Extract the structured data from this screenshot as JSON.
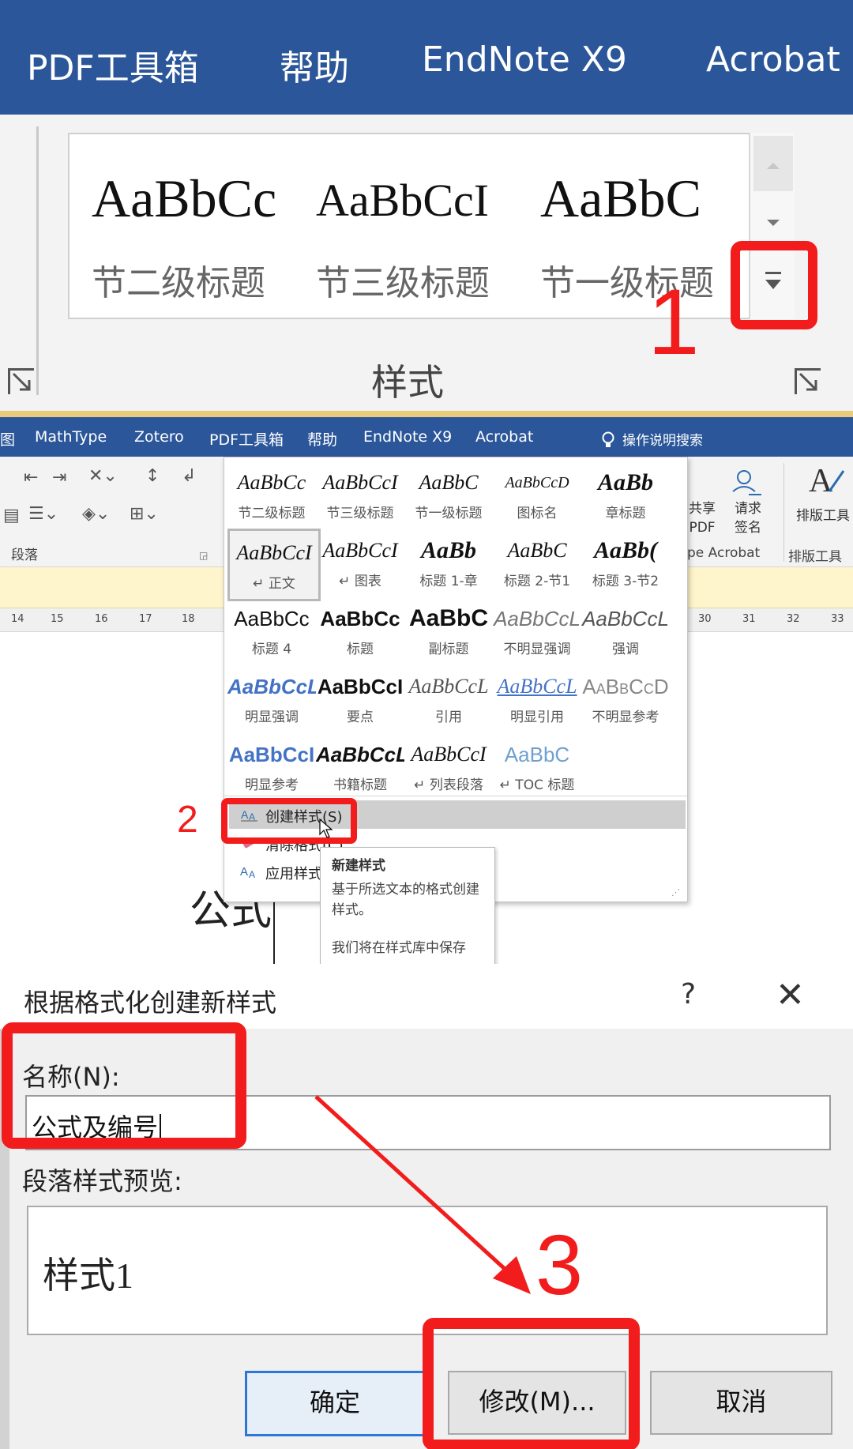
{
  "panel1": {
    "tabs": [
      "PDF工具箱",
      "帮助",
      "EndNote X9",
      "Acrobat"
    ],
    "gallery": [
      {
        "preview": "AaBbCc",
        "name": "节二级标题"
      },
      {
        "preview": "AaBbCcI",
        "name": "节三级标题"
      },
      {
        "preview": "AaBbC",
        "name": "节一级标题"
      }
    ],
    "group_label": "样式",
    "step_number": "1"
  },
  "panel2": {
    "tabs": [
      "图",
      "MathType",
      "Zotero",
      "PDF工具箱",
      "帮助",
      "EndNote X9",
      "Acrobat",
      "操作说明搜索"
    ],
    "ribbon": {
      "paragraph_group": "段落",
      "share_pdf": [
        "共享",
        "PDF"
      ],
      "request_sign": [
        "请求",
        "签名"
      ],
      "typeset_tool": "排版工具",
      "typeset_group": "排版工具箱",
      "acrobat_group": "pe Acrobat"
    },
    "ruler_numbers": [
      "14",
      "15",
      "16",
      "17",
      "18",
      "30",
      "31",
      "32",
      "33"
    ],
    "styles": [
      {
        "preview": "AaBbCc",
        "name": "节二级标题"
      },
      {
        "preview": "AaBbCcI",
        "name": "节三级标题"
      },
      {
        "preview": "AaBbC",
        "name": "节一级标题"
      },
      {
        "preview": "AaBbCcD",
        "name": "图标名"
      },
      {
        "preview": "AaBb",
        "name": "章标题"
      },
      {
        "preview": "AaBbCcI",
        "name": "↵ 正文"
      },
      {
        "preview": "AaBbCcI",
        "name": "↵ 图表"
      },
      {
        "preview": "AaBb",
        "name": "标题 1-章"
      },
      {
        "preview": "AaBbC",
        "name": "标题 2-节1"
      },
      {
        "preview": "AaBb(",
        "name": "标题 3-节2"
      },
      {
        "preview": "AaBbCc",
        "name": "标题 4"
      },
      {
        "preview": "AaBbCc",
        "name": "标题"
      },
      {
        "preview": "AaBbC",
        "name": "副标题"
      },
      {
        "preview": "AaBbCcL",
        "name": "不明显强调"
      },
      {
        "preview": "AaBbCcL",
        "name": "强调"
      },
      {
        "preview": "AaBbCcL",
        "name": "明显强调"
      },
      {
        "preview": "AaBbCcI",
        "name": "要点"
      },
      {
        "preview": "AaBbCcL",
        "name": "引用"
      },
      {
        "preview": "AaBbCcL",
        "name": "明显引用"
      },
      {
        "preview": "AaBbCcD",
        "name": "不明显参考"
      },
      {
        "preview": "AaBbCcI",
        "name": "明显参考"
      },
      {
        "preview": "AaBbCcL",
        "name": "书籍标题"
      },
      {
        "preview": "AaBbCcI",
        "name": "↵ 列表段落"
      },
      {
        "preview": "AaBbC",
        "name": "↵ TOC 标题"
      }
    ],
    "menu": {
      "create": "创建样式(S)",
      "clear": "清除格式(C)",
      "apply": "应用样式"
    },
    "tooltip": {
      "title": "新建样式",
      "body": "基于所选文本的格式创建样式。",
      "more": "我们将在样式库中保存"
    },
    "doc_text": "公式",
    "step_number": "2"
  },
  "panel3": {
    "title": "根据格式化创建新样式",
    "help": "?",
    "close": "✕",
    "name_label": "名称(N):",
    "name_value": "公式及编号",
    "preview_label": "段落样式预览:",
    "preview_text": "样式1",
    "buttons": {
      "ok": "确定",
      "modify": "修改(M)...",
      "cancel": "取消"
    },
    "step_number": "3"
  },
  "colors": {
    "ribbon_blue": "#2b579a",
    "annotation_red": "#f21c1c",
    "focus_blue": "#2d78d6"
  }
}
